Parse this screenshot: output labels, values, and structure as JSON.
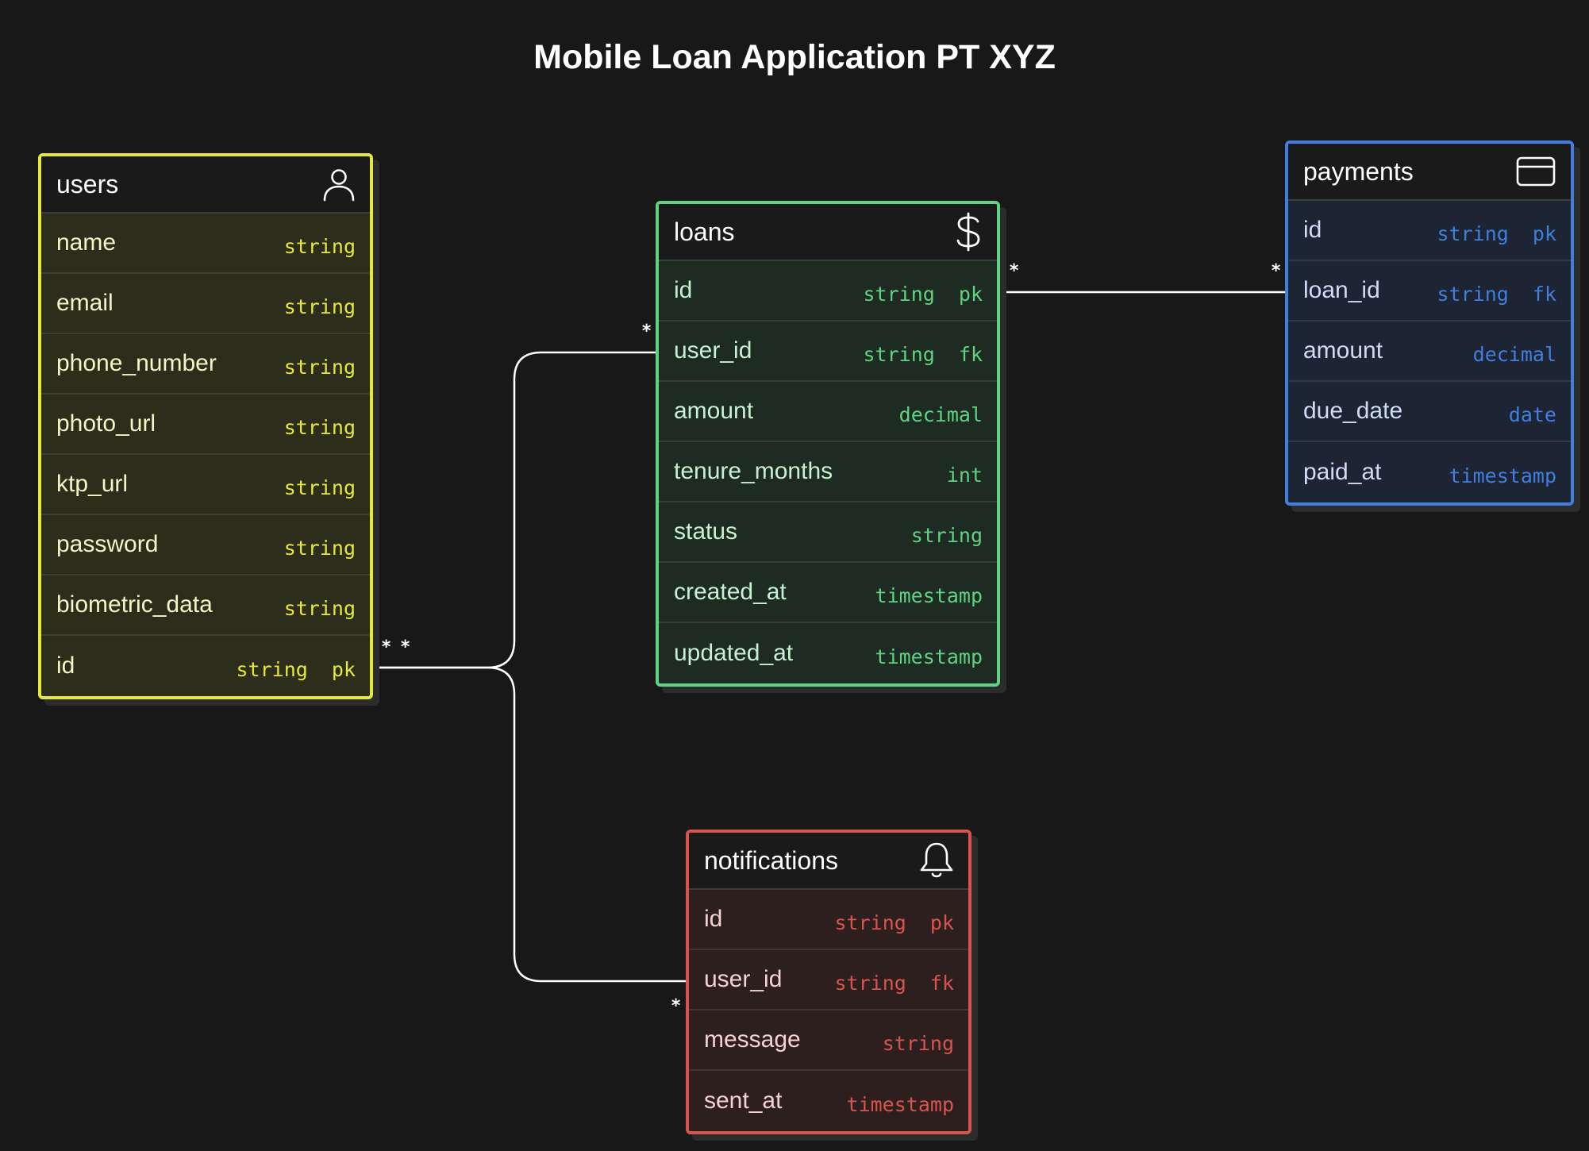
{
  "diagram": {
    "title": "Mobile Loan Application PT XYZ",
    "tables": [
      {
        "name": "users",
        "icon": "user-icon",
        "color": "#e8e83a",
        "fields": [
          {
            "name": "name",
            "type": "string"
          },
          {
            "name": "email",
            "type": "string"
          },
          {
            "name": "phone_number",
            "type": "string"
          },
          {
            "name": "photo_url",
            "type": "string"
          },
          {
            "name": "ktp_url",
            "type": "string"
          },
          {
            "name": "password",
            "type": "string"
          },
          {
            "name": "biometric_data",
            "type": "string"
          },
          {
            "name": "id",
            "type": "string  pk"
          }
        ]
      },
      {
        "name": "loans",
        "icon": "dollar-icon",
        "color": "#5fd382",
        "fields": [
          {
            "name": "id",
            "type": "string  pk"
          },
          {
            "name": "user_id",
            "type": "string  fk"
          },
          {
            "name": "amount",
            "type": "decimal"
          },
          {
            "name": "tenure_months",
            "type": "int"
          },
          {
            "name": "status",
            "type": "string"
          },
          {
            "name": "created_at",
            "type": "timestamp"
          },
          {
            "name": "updated_at",
            "type": "timestamp"
          }
        ]
      },
      {
        "name": "payments",
        "icon": "credit-card-icon",
        "color": "#3f7fe0",
        "fields": [
          {
            "name": "id",
            "type": "string  pk"
          },
          {
            "name": "loan_id",
            "type": "string  fk"
          },
          {
            "name": "amount",
            "type": "decimal"
          },
          {
            "name": "due_date",
            "type": "date"
          },
          {
            "name": "paid_at",
            "type": "timestamp"
          }
        ]
      },
      {
        "name": "notifications",
        "icon": "bell-icon",
        "color": "#d9544f",
        "fields": [
          {
            "name": "id",
            "type": "string  pk"
          },
          {
            "name": "user_id",
            "type": "string  fk"
          },
          {
            "name": "message",
            "type": "string"
          },
          {
            "name": "sent_at",
            "type": "timestamp"
          }
        ]
      }
    ],
    "relationships": [
      {
        "from": "users.id",
        "to": "loans.user_id",
        "from_card": "*",
        "to_card": "*"
      },
      {
        "from": "users.id",
        "to": "notifications.user_id",
        "from_card": "*",
        "to_card": "*"
      },
      {
        "from": "loans.id",
        "to": "payments.loan_id",
        "from_card": "*",
        "to_card": "*"
      }
    ]
  }
}
